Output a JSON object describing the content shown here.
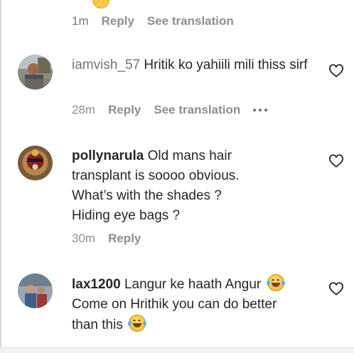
{
  "top_comment": {
    "time": "1m",
    "reply_label": "Reply",
    "translate_label": "See translation"
  },
  "comments": [
    {
      "username": "iamvish_57",
      "text": "Hritik ko yahiili mili thiss sirf",
      "time": "28m",
      "reply_label": "Reply",
      "translate_label": "See translation"
    },
    {
      "username": "pollynarula",
      "text_lines": [
        "Old mans hair",
        "transplant is soooo obvious.",
        "What’s with the shades ?",
        "Hiding eye bags ?"
      ],
      "time": "30m",
      "reply_label": "Reply"
    },
    {
      "username": "lax1200",
      "text_line1": "Langur ke haath Angur",
      "text_line2": "Come on Hrithik you can do better",
      "text_line3": "than this",
      "time": "",
      "reply_label": ""
    }
  ],
  "icons": {
    "like": "heart-outline-icon",
    "more": "more-options-icon",
    "emoji": "face-with-tears-of-joy-emoji"
  },
  "colors": {
    "text": "#262626",
    "muted": "#737373",
    "background": "#ffffff"
  }
}
